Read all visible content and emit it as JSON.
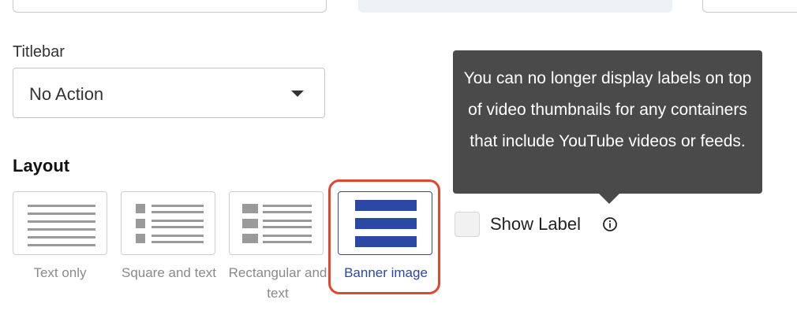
{
  "titlebar": {
    "label": "Titlebar",
    "selected": "No Action"
  },
  "layout": {
    "title": "Layout",
    "options": [
      {
        "caption": "Text only"
      },
      {
        "caption": "Square and text"
      },
      {
        "caption": "Rectangular and text"
      },
      {
        "caption": "Banner image",
        "selected": true
      }
    ]
  },
  "tooltip": {
    "text": "You can no longer display labels on top of video thumbnails for any containers that include YouTube videos or feeds."
  },
  "show_label": {
    "label": "Show Label",
    "checked": false
  },
  "colors": {
    "accent": "#2b48a4",
    "highlight": "#e1472f",
    "tooltip_bg": "#4a4a4a"
  },
  "icons": {
    "select": "caret-down-icon",
    "info": "info-icon"
  }
}
